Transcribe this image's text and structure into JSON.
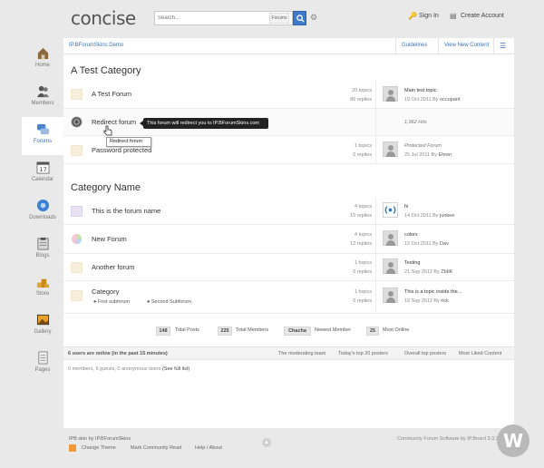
{
  "header": {
    "logo": "concise",
    "search_placeholder": "Search...",
    "search_scope": "Forums",
    "sign_in": "Sign In",
    "create_account": "Create Account"
  },
  "sidebar": {
    "items": [
      {
        "label": "Home",
        "icon": "home-icon"
      },
      {
        "label": "Members",
        "icon": "members-icon"
      },
      {
        "label": "Forums",
        "icon": "forums-icon",
        "active": true
      },
      {
        "label": "Calendar",
        "icon": "calendar-icon",
        "day": "17"
      },
      {
        "label": "Downloads",
        "icon": "downloads-icon"
      },
      {
        "label": "Blogs",
        "icon": "blogs-icon"
      },
      {
        "label": "Store",
        "icon": "store-icon"
      },
      {
        "label": "Gallery",
        "icon": "gallery-icon"
      },
      {
        "label": "Pages",
        "icon": "pages-icon"
      }
    ]
  },
  "nav": {
    "breadcrumb": "IP.BForumSkins Demo",
    "guidelines": "Guidelines",
    "new_content": "View New Content"
  },
  "categories": [
    {
      "title": "A Test Category",
      "forums": [
        {
          "name": "A Test Forum",
          "topics": "20 topics",
          "replies": "86 replies",
          "last_title": "Main test topic",
          "last_date": "19 Oct 2011",
          "last_by": "By",
          "last_user": "occupant"
        },
        {
          "name": "Redirect forum",
          "hits": "1,962 Hits"
        },
        {
          "name": "Password protected",
          "topics": "1 topics",
          "replies": "0 replies",
          "last_title": "Protected Forum",
          "last_date": "25 Jul 2011",
          "last_by": "By",
          "last_user": "Ehren"
        }
      ]
    },
    {
      "title": "Category Name",
      "forums": [
        {
          "name": "This is the forum name",
          "topics": "4 topics",
          "replies": "15 replies",
          "last_title": "hi",
          "last_date": "14 Oct 2011",
          "last_by": "By",
          "last_user": "junkee"
        },
        {
          "name": "New Forum",
          "topics": "4 topics",
          "replies": "12 replies",
          "last_title": "colors",
          "last_date": "12 Oct 2011",
          "last_by": "By",
          "last_user": "Dav"
        },
        {
          "name": "Another forum",
          "topics": "1 topics",
          "replies": "0 replies",
          "last_title": "Testing",
          "last_date": "21 Sep 2011",
          "last_by": "By",
          "last_user": "ZbItK"
        },
        {
          "name": "Category",
          "topics": "1 topics",
          "replies": "0 replies",
          "last_title": "This is a topic inside the...",
          "last_date": "19 Sep 2011",
          "last_by": "By",
          "last_user": "rick",
          "subforums": [
            "First subforum",
            "Second Subforum"
          ]
        }
      ]
    }
  ],
  "redirect_tooltip": "This forum will redirect you to IP.BForumSkins.com",
  "hover_tooltip": "Redirect forum",
  "stats": {
    "total_posts_value": "148",
    "total_posts_label": "Total Posts",
    "total_members_value": "225",
    "total_members_label": "Total Members",
    "newest_member_value": "Chacha",
    "newest_member_label": "Newest Member",
    "most_online_value": "25",
    "most_online_label": "Most Online"
  },
  "online": {
    "title": "6 users are online (in the past 15 minutes)",
    "links": [
      "The moderating team",
      "Today's top 20 posters",
      "Overall top posters",
      "Most Liked Content"
    ],
    "list": "0 members, 6 guests, 0 anonymous users",
    "full_list": "(See full list)"
  },
  "footer": {
    "skin_credit": "IPB skin by IP.BForumSkins",
    "change_theme": "Change Theme",
    "mark_read": "Mark Community Read",
    "help": "Help / About",
    "powered": "Community Forum Software by IP.Board 3.3.3",
    "watermark": "W"
  },
  "colors": {
    "accent": "#3c73b8",
    "folder": "#f6efdc",
    "rss": "#f19a35"
  }
}
